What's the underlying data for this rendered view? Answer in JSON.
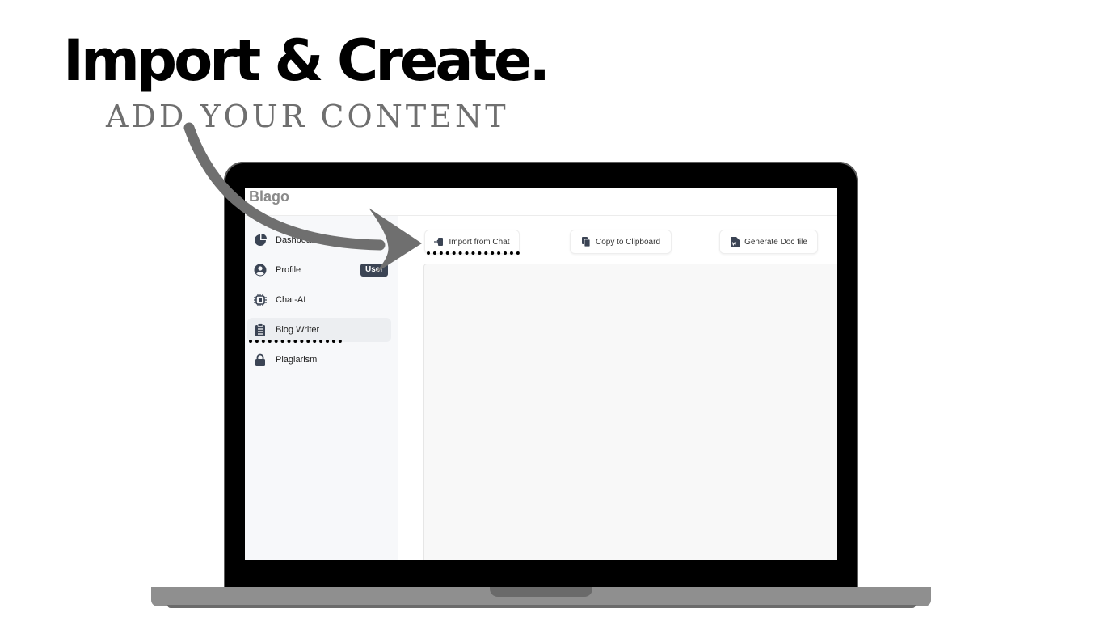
{
  "hero": {
    "title": "Import & Create.",
    "subtitle": "ADD YOUR CONTENT"
  },
  "app": {
    "brand": "Blago",
    "sidebar": {
      "items": [
        {
          "label": "Dashboard",
          "icon": "pie-chart-icon",
          "active": false
        },
        {
          "label": "Profile",
          "icon": "user-circle-icon",
          "active": false,
          "badge": "User"
        },
        {
          "label": "Chat-AI",
          "icon": "chip-icon",
          "active": false
        },
        {
          "label": "Blog Writer",
          "icon": "clipboard-list-icon",
          "active": true
        },
        {
          "label": "Plagiarism",
          "icon": "lock-icon",
          "active": false
        }
      ]
    },
    "toolbar": {
      "import_label": "Import from Chat",
      "copy_label": "Copy to Clipboard",
      "doc_label": "Generate Doc file"
    },
    "editor": {
      "value": ""
    }
  },
  "colors": {
    "arrow": "#6f6f6f",
    "badge": "#3b4454",
    "sidebar_bg": "#f7f8fa"
  }
}
